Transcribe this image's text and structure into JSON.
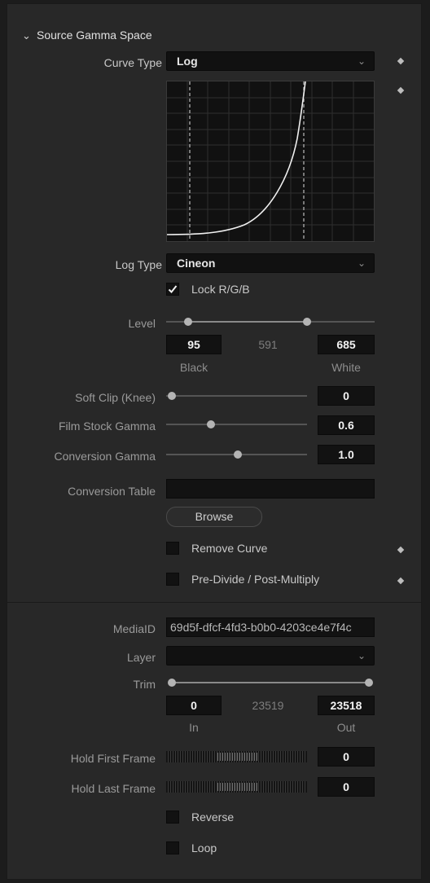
{
  "section": {
    "title": "Source Gamma Space"
  },
  "curve_type": {
    "label": "Curve Type",
    "value": "Log"
  },
  "log_type": {
    "label": "Log Type",
    "value": "Cineon"
  },
  "lock_rgb": {
    "label": "Lock R/G/B",
    "checked": true
  },
  "level": {
    "label": "Level",
    "black": "95",
    "mid": "591",
    "white": "685",
    "black_label": "Black",
    "white_label": "White",
    "black_fraction": 0.11,
    "white_fraction": 0.67
  },
  "soft_clip": {
    "label": "Soft Clip (Knee)",
    "value": "0",
    "fraction": 0.0
  },
  "film_stock_gamma": {
    "label": "Film Stock Gamma",
    "value": "0.6",
    "fraction": 0.3
  },
  "conversion_gamma": {
    "label": "Conversion Gamma",
    "value": "1.0",
    "fraction": 0.5
  },
  "conversion_table": {
    "label": "Conversion Table",
    "value": ""
  },
  "browse": {
    "label": "Browse"
  },
  "remove_curve": {
    "label": "Remove Curve",
    "checked": false
  },
  "pre_divide": {
    "label": "Pre-Divide / Post-Multiply",
    "checked": false
  },
  "media_id": {
    "label": "MediaID",
    "value": "69d5f-dfcf-4fd3-b0b0-4203ce4e7f4c"
  },
  "layer": {
    "label": "Layer",
    "value": ""
  },
  "trim": {
    "label": "Trim",
    "in": "0",
    "mid": "23519",
    "out": "23518",
    "in_label": "In",
    "out_label": "Out"
  },
  "hold_first_frame": {
    "label": "Hold First Frame",
    "value": "0"
  },
  "hold_last_frame": {
    "label": "Hold Last Frame",
    "value": "0"
  },
  "reverse": {
    "label": "Reverse",
    "checked": false
  },
  "loop": {
    "label": "Loop",
    "checked": false
  },
  "icons": {
    "section_toggle": "chevron-down-icon",
    "dropdown": "chevron-down-icon",
    "keyframe": "diamond-icon",
    "checkmark": "checkmark-icon"
  }
}
